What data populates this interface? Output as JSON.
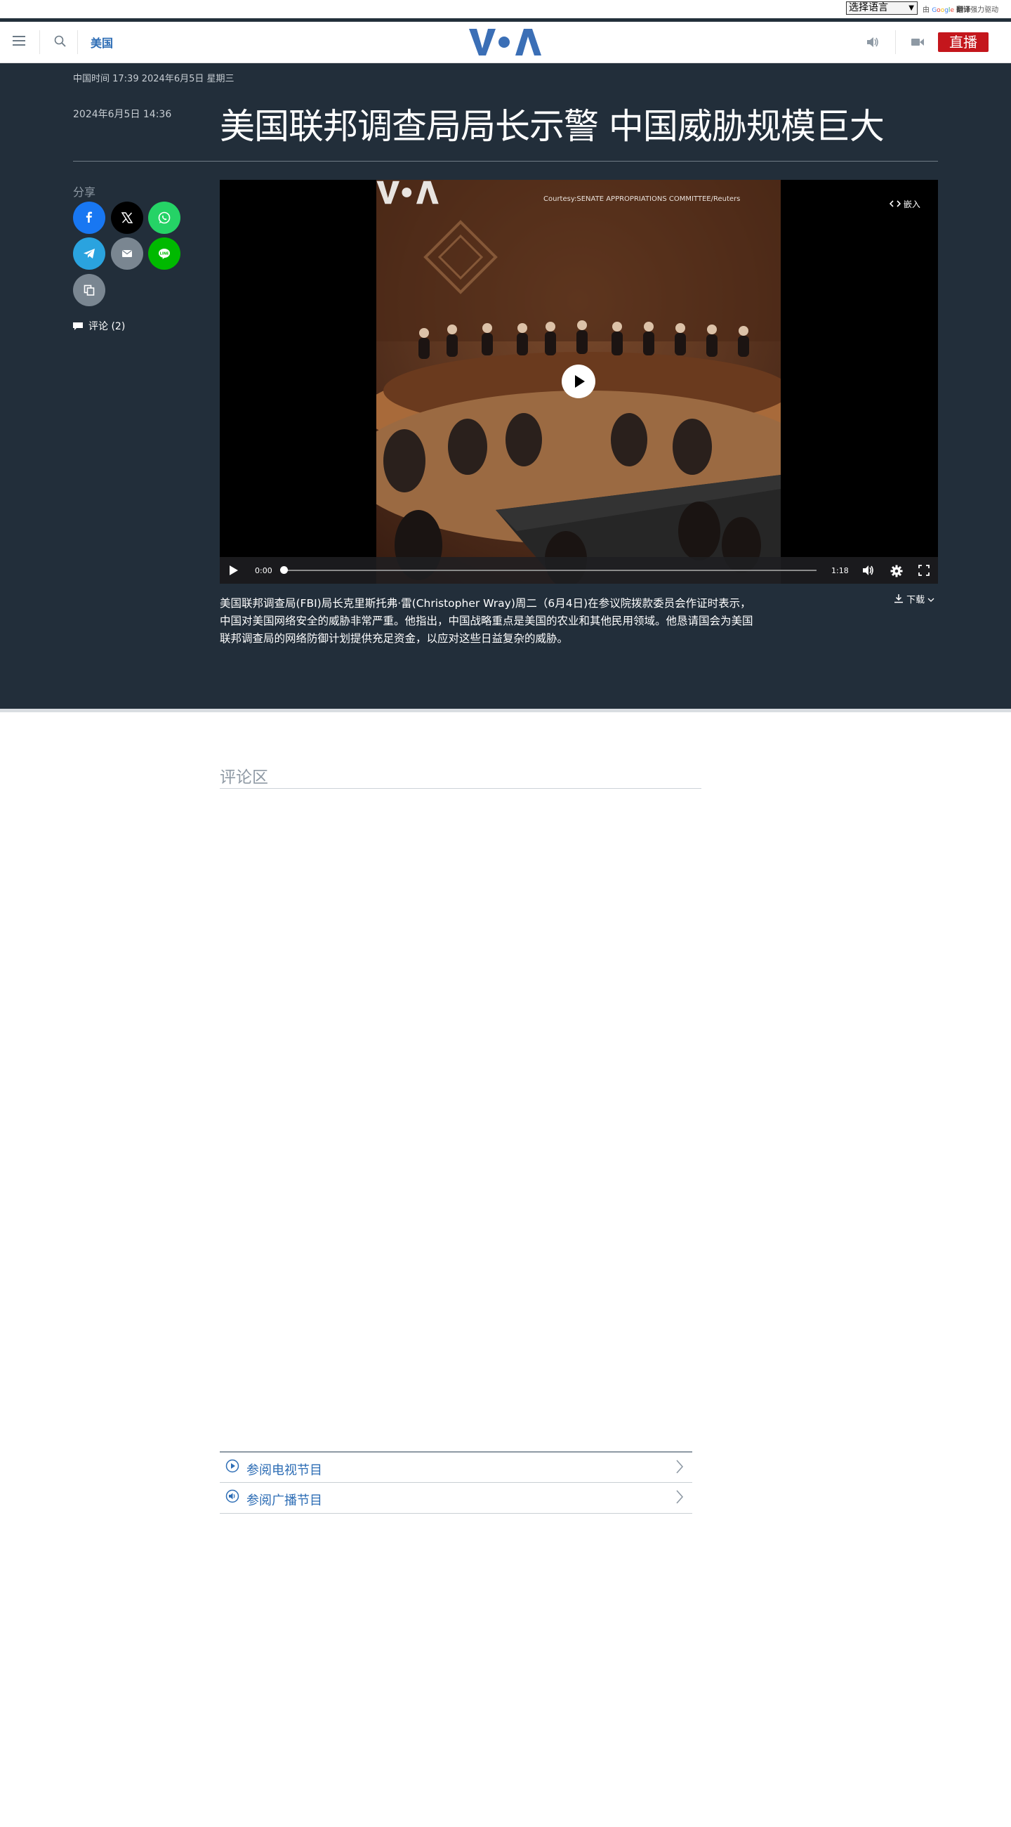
{
  "translate": {
    "select_value": "选择语言",
    "powered_prefix": "由",
    "google": "Google",
    "translate_word": "翻译",
    "powered_suffix": "强力驱动"
  },
  "header": {
    "section": "美国",
    "live_label": "直播",
    "logo_alt": "VOA"
  },
  "article": {
    "date_line": "中国时间 17:39 2024年6月5日 星期三",
    "published": "2024年6月5日 14:36",
    "headline": "美国联邦调查局局长示警 中国威胁规模巨大",
    "share_label": "分享",
    "share_buttons": [
      "facebook-icon",
      "x-icon",
      "whatsapp-icon",
      "telegram-icon",
      "email-icon",
      "line-icon",
      "copy-link-icon"
    ],
    "comments_link": "评论 (2)",
    "caption": "美国联邦调查局(FBI)局长克里斯托弗·雷(Christopher Wray)周二（6月4日)在参议院拨款委员会作证时表示，中国对美国网络安全的威胁非常严重。他指出，中国战略重点是美国的农业和其他民用领域。他恳请国会为美国联邦调查局的网络防御计划提供充足资金，以应对这些日益复杂的威胁。",
    "download_label": "下载"
  },
  "video": {
    "courtesy": "Courtesy:SENATE APPROPRIATIONS COMMITTEE/Reuters",
    "embed_label": "嵌入",
    "current_time": "0:00",
    "duration": "1:18",
    "progress": 0
  },
  "comments": {
    "title": "评论区"
  },
  "programs": [
    {
      "label": "参阅电视节目",
      "icon": "play-circle-icon"
    },
    {
      "label": "参阅广播节目",
      "icon": "audio-circle-icon"
    }
  ],
  "colors": {
    "brand_blue": "#2d6db5",
    "live_red": "#c4161c",
    "dark_bg": "#222e3a"
  }
}
